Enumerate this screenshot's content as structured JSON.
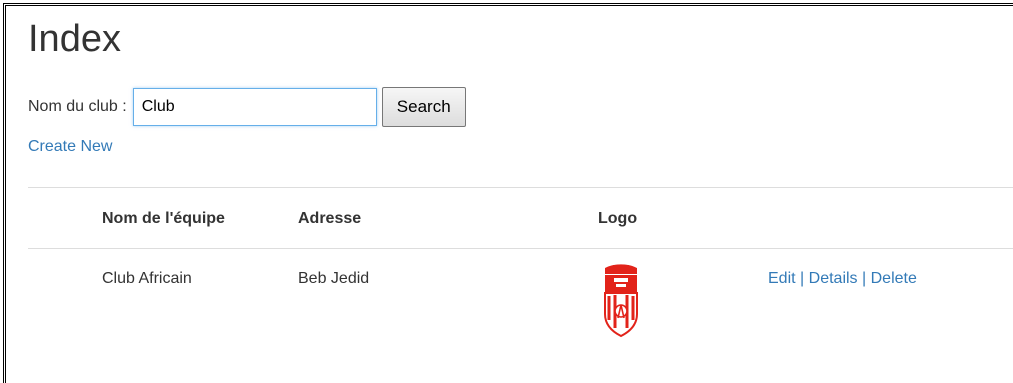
{
  "page": {
    "title": "Index"
  },
  "search": {
    "label": "Nom du club :",
    "value": "Club",
    "button_label": "Search"
  },
  "create_link": "Create New",
  "table": {
    "headers": [
      "Nom de l'équipe",
      "Adresse",
      "Logo",
      ""
    ],
    "rows": [
      {
        "nom": "Club Africain",
        "adresse": "Beb Jedid",
        "logo_icon": "club-africain-crest",
        "actions": {
          "edit": "Edit",
          "details": "Details",
          "delete": "Delete",
          "separator": "|"
        }
      }
    ]
  },
  "colors": {
    "link": "#337ab7",
    "logo_red": "#e2231a",
    "focus_border": "#66afe9"
  }
}
